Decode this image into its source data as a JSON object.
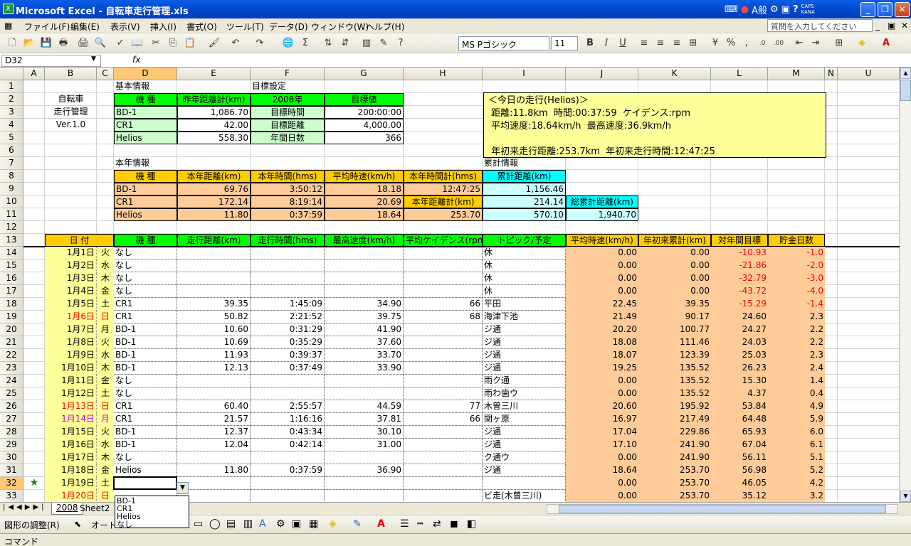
{
  "window": {
    "title": "Microsoft Excel - 自転車走行管理.xls",
    "ime_mode": "A般",
    "caps": "CAPS",
    "kana": "KANA"
  },
  "menu": {
    "items": [
      "ファイル(F)",
      "編集(E)",
      "表示(V)",
      "挿入(I)",
      "書式(O)",
      "ツール(T)",
      "データ(D)",
      "ウィンドウ(W)",
      "ヘルプ(H)"
    ],
    "help_placeholder": "質問を入力してください"
  },
  "format": {
    "font": "MS Pゴシック",
    "size": "11"
  },
  "formula": {
    "namebox": "D32",
    "fx": "fx",
    "value": ""
  },
  "columns": [
    "A",
    "B",
    "C",
    "D",
    "E",
    "F",
    "G",
    "H",
    "I",
    "J",
    "K",
    "L",
    "M",
    "N",
    "U"
  ],
  "sheet": {
    "app_title": [
      "自転車",
      "走行管理",
      "Ver.1.0"
    ],
    "basic": {
      "label": "基本情報",
      "h_type": "機 種",
      "h_dist": "昨年距離計(km)",
      "rows": [
        [
          "BD-1",
          "1,086.70"
        ],
        [
          "CR1",
          "42.00"
        ],
        [
          "Helios",
          "558.30"
        ]
      ]
    },
    "goal": {
      "label": "目標設定",
      "h_year": "2008年",
      "h_val": "目標値",
      "rows": [
        [
          "目標時間",
          "200:00:00"
        ],
        [
          "目標距離",
          "4,000.00"
        ],
        [
          "年間日数",
          "366"
        ]
      ]
    },
    "info": {
      "l1": "＜今日の走行(Helios)＞",
      "l2": " 距離:11.8km  時間:00:37:59  ケイデンス:rpm",
      "l3": " 平均速度:18.64km/h  最高速度:36.9km/h",
      "l4": "",
      "l5": " 年初来走行距離:253.7km  年初来走行時間:12:47:25"
    },
    "year": {
      "label": "本年情報",
      "h": [
        "機 種",
        "本年距離(km)",
        "本年時間(hms)",
        "平均時速(km/h)",
        "本年時間計(hms)"
      ],
      "rows": [
        [
          "BD-1",
          "69.76",
          "3:50:12",
          "18.18"
        ],
        [
          "CR1",
          "172.14",
          "8:19:14",
          "20.69"
        ],
        [
          "Helios",
          "11.80",
          "0:37:59",
          "18.64"
        ]
      ],
      "total_time": "12:47:25",
      "dist_label": "本年距離計(km)",
      "dist_total": "253.70"
    },
    "cum": {
      "label": "累計情報",
      "h": "累計距離(km)",
      "vals": [
        "1,156.46",
        "214.14",
        "570.10"
      ],
      "total_label": "総累計距離(km)",
      "total": "1,940.70"
    },
    "log_headers": [
      "日 付",
      "機 種",
      "走行距離(km)",
      "走行時間(hms)",
      "最高速度(km/h)",
      "平均ケイデンス(rpm)",
      "トピック/予定",
      "平均時速(km/h)",
      "年初来累計(km)",
      "対年間目標",
      "貯金日数"
    ],
    "log": [
      [
        "1月1日",
        "火",
        "なし",
        "",
        "",
        "",
        "",
        "休",
        "0.00",
        "0.00",
        "-10.93",
        "-1.0"
      ],
      [
        "1月2日",
        "水",
        "なし",
        "",
        "",
        "",
        "",
        "休",
        "0.00",
        "0.00",
        "-21.86",
        "-2.0"
      ],
      [
        "1月3日",
        "木",
        "なし",
        "",
        "",
        "",
        "",
        "休",
        "0.00",
        "0.00",
        "-32.79",
        "-3.0"
      ],
      [
        "1月4日",
        "金",
        "なし",
        "",
        "",
        "",
        "",
        "休",
        "0.00",
        "0.00",
        "-43.72",
        "-4.0"
      ],
      [
        "1月5日",
        "土",
        "CR1",
        "39.35",
        "1:45:09",
        "34.90",
        "66",
        "平田",
        "22.45",
        "39.35",
        "-15.29",
        "-1.4"
      ],
      [
        "1月6日",
        "日",
        "CR1",
        "50.82",
        "2:21:52",
        "39.75",
        "68",
        "海津下池",
        "21.49",
        "90.17",
        "24.60",
        "2.3"
      ],
      [
        "1月7日",
        "月",
        "BD-1",
        "10.60",
        "0:31:29",
        "41.90",
        "",
        "ジ通",
        "20.20",
        "100.77",
        "24.27",
        "2.2"
      ],
      [
        "1月8日",
        "火",
        "BD-1",
        "10.69",
        "0:35:29",
        "37.60",
        "",
        "ジ通",
        "18.08",
        "111.46",
        "24.03",
        "2.2"
      ],
      [
        "1月9日",
        "水",
        "BD-1",
        "11.93",
        "0:39:37",
        "33.70",
        "",
        "ジ通",
        "18.07",
        "123.39",
        "25.03",
        "2.3"
      ],
      [
        "1月10日",
        "木",
        "BD-1",
        "12.13",
        "0:37:49",
        "33.90",
        "",
        "ジ通",
        "19.25",
        "135.52",
        "26.23",
        "2.4"
      ],
      [
        "1月11日",
        "金",
        "なし",
        "",
        "",
        "",
        "",
        "雨ク通",
        "0.00",
        "135.52",
        "15.30",
        "1.4"
      ],
      [
        "1月12日",
        "土",
        "なし",
        "",
        "",
        "",
        "",
        "雨わ歯ウ",
        "0.00",
        "135.52",
        "4.37",
        "0.4"
      ],
      [
        "1月13日",
        "日",
        "CR1",
        "60.40",
        "2:55:57",
        "44.59",
        "77",
        "木曽三川",
        "20.60",
        "195.92",
        "53.84",
        "4.9"
      ],
      [
        "1月14日",
        "月",
        "CR1",
        "21.57",
        "1:16:16",
        "37.81",
        "66",
        "関ヶ原",
        "16.97",
        "217.49",
        "64.48",
        "5.9"
      ],
      [
        "1月15日",
        "火",
        "BD-1",
        "12.37",
        "0:43:34",
        "30.10",
        "",
        "ジ通",
        "17.04",
        "229.86",
        "65.93",
        "6.0"
      ],
      [
        "1月16日",
        "水",
        "BD-1",
        "12.04",
        "0:42:14",
        "31.00",
        "",
        "ジ通",
        "17.10",
        "241.90",
        "67.04",
        "6.1"
      ],
      [
        "1月17日",
        "木",
        "なし",
        "",
        "",
        "",
        "",
        "ク通ウ",
        "0.00",
        "241.90",
        "56.11",
        "5.1"
      ],
      [
        "1月18日",
        "金",
        "Helios",
        "11.80",
        "0:37:59",
        "36.90",
        "",
        "ジ通",
        "18.64",
        "253.70",
        "56.98",
        "5.2"
      ],
      [
        "1月19日",
        "土",
        "",
        "",
        "",
        "",
        "",
        "",
        "0.00",
        "253.70",
        "46.05",
        "4.2"
      ],
      [
        "1月20日",
        "日",
        "",
        "",
        "",
        "",
        "",
        "ビ走(木曽三川)",
        "0.00",
        "253.70",
        "35.12",
        "3.2"
      ]
    ],
    "dropdown": [
      "BD-1",
      "CR1",
      "Helios",
      "なし"
    ],
    "star": "★"
  },
  "tabs": [
    "2008",
    "Sheet2"
  ],
  "draw": {
    "adjust": "図形の調整(R)",
    "autoshape": "オート"
  },
  "status": "コマンド"
}
